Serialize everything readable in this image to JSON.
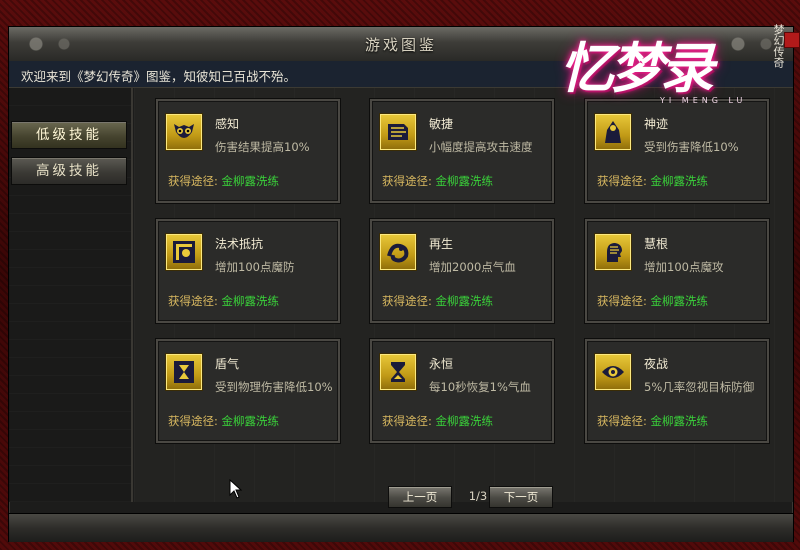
{
  "window": {
    "title": "游戏图鉴",
    "welcome": "欢迎来到《梦幻传奇》图鉴，知彼知己百战不殆。"
  },
  "logo": {
    "main": "忆梦录",
    "sub": "YI MENG LU",
    "side": "梦幻传奇"
  },
  "sidebar": {
    "items": [
      {
        "label": "低级技能",
        "active": true
      },
      {
        "label": "高级技能",
        "active": false
      }
    ]
  },
  "skills": [
    {
      "name": "感知",
      "desc": "伤害结果提高10%",
      "icon": "owl-icon",
      "source_label": "获得途径:",
      "source_value": "金柳露洗练"
    },
    {
      "name": "敏捷",
      "desc": "小幅度提高攻击速度",
      "icon": "speed-scroll-icon",
      "source_label": "获得途径:",
      "source_value": "金柳露洗练"
    },
    {
      "name": "神迹",
      "desc": "受到伤害降低10%",
      "icon": "holy-figure-icon",
      "source_label": "获得途径:",
      "source_value": "金柳露洗练"
    },
    {
      "name": "法术抵抗",
      "desc": "增加100点魔防",
      "icon": "magic-resist-icon",
      "source_label": "获得途径:",
      "source_value": "金柳露洗练"
    },
    {
      "name": "再生",
      "desc": "增加2000点气血",
      "icon": "regen-creature-icon",
      "source_label": "获得途径:",
      "source_value": "金柳露洗练"
    },
    {
      "name": "慧根",
      "desc": "增加100点魔攻",
      "icon": "wisdom-head-icon",
      "source_label": "获得途径:",
      "source_value": "金柳露洗练"
    },
    {
      "name": "盾气",
      "desc": "受到物理伤害降低10%",
      "icon": "shield-hourglass-icon",
      "source_label": "获得途径:",
      "source_value": "金柳露洗练"
    },
    {
      "name": "永恒",
      "desc": "每10秒恢复1%气血",
      "icon": "hourglass-icon",
      "source_label": "获得途径:",
      "source_value": "金柳露洗练"
    },
    {
      "name": "夜战",
      "desc": "5%几率忽视目标防御",
      "icon": "eye-icon",
      "source_label": "获得途径:",
      "source_value": "金柳露洗练"
    }
  ],
  "pager": {
    "prev": "上一页",
    "next": "下一页",
    "current": "1/3"
  },
  "colors": {
    "frame_red": "#4a0808",
    "icon_gold": "#d9b226",
    "source_green": "#3ad43a",
    "source_label": "#d8b860"
  }
}
